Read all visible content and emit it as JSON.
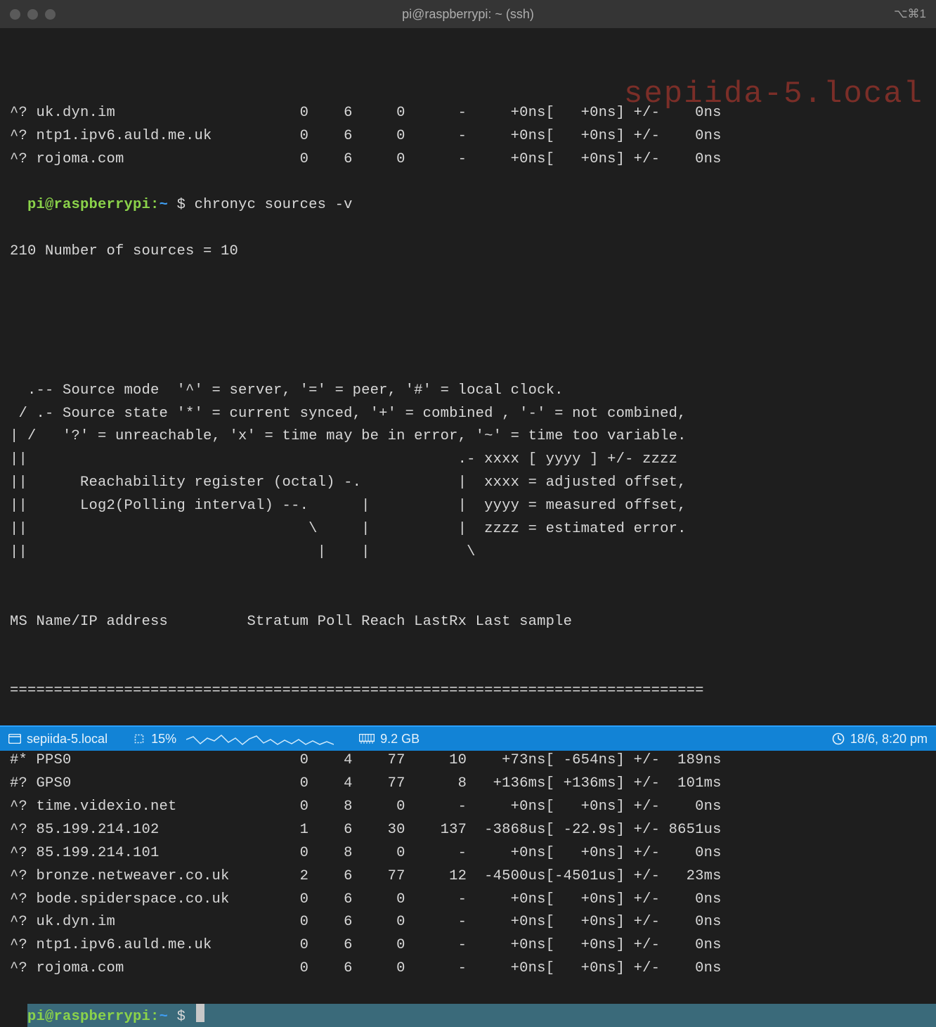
{
  "window": {
    "title": "pi@raspberrypi: ~ (ssh)",
    "hotkey": "⌥⌘1"
  },
  "watermark": "sepiida-5.local",
  "prompt": {
    "user_host": "pi@raspberrypi",
    "path": "~",
    "symbol": "$"
  },
  "command": "chronyc sources -v",
  "status_line": "210 Number of sources = 10",
  "legend": [
    "  .-- Source mode  '^' = server, '=' = peer, '#' = local clock.",
    " / .- Source state '*' = current synced, '+' = combined , '-' = not combined,",
    "| /   '?' = unreachable, 'x' = time may be in error, '~' = time too variable.",
    "||                                                 .- xxxx [ yyyy ] +/- zzzz",
    "||      Reachability register (octal) -.           |  xxxx = adjusted offset,",
    "||      Log2(Polling interval) --.      |          |  yyyy = measured offset,",
    "||                                \\     |          |  zzzz = estimated error.",
    "||                                 |    |           \\"
  ],
  "header": "MS Name/IP address         Stratum Poll Reach LastRx Last sample",
  "divider": "===============================================================================",
  "prev_rows": [
    {
      "ms": "^?",
      "name": "uk.dyn.im",
      "stratum": "0",
      "poll": "6",
      "reach": "0",
      "lastrx": "-",
      "adj": "+0ns",
      "meas": "+0ns",
      "err": "0ns"
    },
    {
      "ms": "^?",
      "name": "ntp1.ipv6.auld.me.uk",
      "stratum": "0",
      "poll": "6",
      "reach": "0",
      "lastrx": "-",
      "adj": "+0ns",
      "meas": "+0ns",
      "err": "0ns"
    },
    {
      "ms": "^?",
      "name": "rojoma.com",
      "stratum": "0",
      "poll": "6",
      "reach": "0",
      "lastrx": "-",
      "adj": "+0ns",
      "meas": "+0ns",
      "err": "0ns"
    }
  ],
  "rows": [
    {
      "ms": "#*",
      "name": "PPS0",
      "stratum": "0",
      "poll": "4",
      "reach": "77",
      "lastrx": "10",
      "adj": "+73ns",
      "meas": "-654ns",
      "err": "189ns"
    },
    {
      "ms": "#?",
      "name": "GPS0",
      "stratum": "0",
      "poll": "4",
      "reach": "77",
      "lastrx": "8",
      "adj": "+136ms",
      "meas": "+136ms",
      "err": "101ms"
    },
    {
      "ms": "^?",
      "name": "time.videxio.net",
      "stratum": "0",
      "poll": "8",
      "reach": "0",
      "lastrx": "-",
      "adj": "+0ns",
      "meas": "+0ns",
      "err": "0ns"
    },
    {
      "ms": "^?",
      "name": "85.199.214.102",
      "stratum": "1",
      "poll": "6",
      "reach": "30",
      "lastrx": "137",
      "adj": "-3868us",
      "meas": "-22.9s",
      "err": "8651us"
    },
    {
      "ms": "^?",
      "name": "85.199.214.101",
      "stratum": "0",
      "poll": "8",
      "reach": "0",
      "lastrx": "-",
      "adj": "+0ns",
      "meas": "+0ns",
      "err": "0ns"
    },
    {
      "ms": "^?",
      "name": "bronze.netweaver.co.uk",
      "stratum": "2",
      "poll": "6",
      "reach": "77",
      "lastrx": "12",
      "adj": "-4500us",
      "meas": "-4501us",
      "err": "23ms"
    },
    {
      "ms": "^?",
      "name": "bode.spiderspace.co.uk",
      "stratum": "0",
      "poll": "6",
      "reach": "0",
      "lastrx": "-",
      "adj": "+0ns",
      "meas": "+0ns",
      "err": "0ns"
    },
    {
      "ms": "^?",
      "name": "uk.dyn.im",
      "stratum": "0",
      "poll": "6",
      "reach": "0",
      "lastrx": "-",
      "adj": "+0ns",
      "meas": "+0ns",
      "err": "0ns"
    },
    {
      "ms": "^?",
      "name": "ntp1.ipv6.auld.me.uk",
      "stratum": "0",
      "poll": "6",
      "reach": "0",
      "lastrx": "-",
      "adj": "+0ns",
      "meas": "+0ns",
      "err": "0ns"
    },
    {
      "ms": "^?",
      "name": "rojoma.com",
      "stratum": "0",
      "poll": "6",
      "reach": "0",
      "lastrx": "-",
      "adj": "+0ns",
      "meas": "+0ns",
      "err": "0ns"
    }
  ],
  "statusbar": {
    "host": "sepiida-5.local",
    "cpu": "15%",
    "ram": "9.2 GB",
    "clock": "18/6, 8:20 pm"
  }
}
